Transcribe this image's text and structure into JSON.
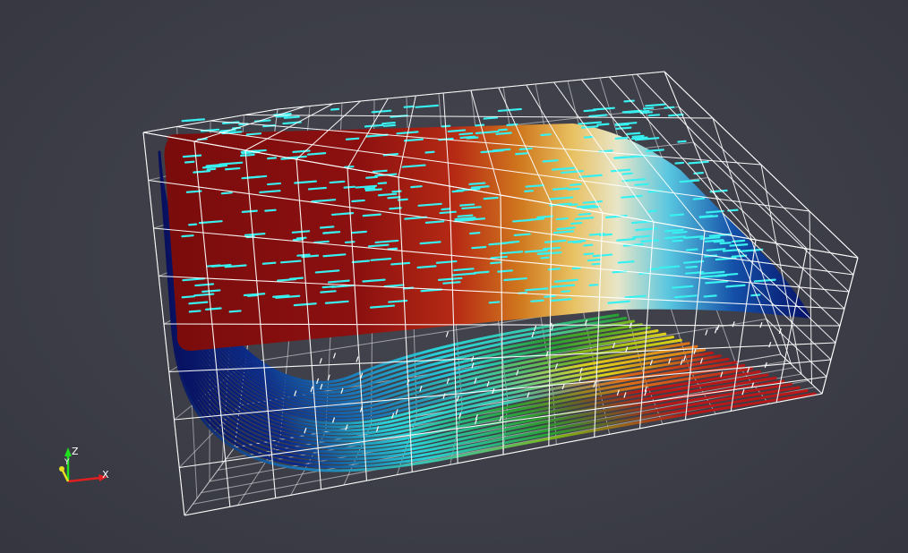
{
  "viewport": {
    "background_color": "#3c3d47",
    "grid_color": "#ffffff",
    "colormap": [
      "#08105e",
      "#0a3a9c",
      "#1aa0c8",
      "#2ee0e0",
      "#dce9c8",
      "#f0d070",
      "#e09a20",
      "#c8501a",
      "#9a1515",
      "#7a0c0c"
    ]
  },
  "orientation_axes": {
    "x_label": "X",
    "y_label": "Y",
    "z_label": "Z",
    "x_color": "#e02020",
    "y_color": "#e6e020",
    "z_color": "#20e020"
  }
}
